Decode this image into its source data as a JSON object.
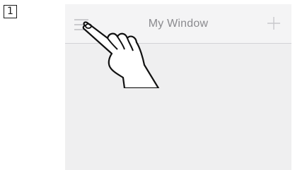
{
  "step": {
    "number": "1"
  },
  "window": {
    "title": "My Window",
    "background_color": "#efeff0",
    "nav_bar_color": "#f4f4f5",
    "icon_color": "#bdbdc1",
    "title_color": "#8a8a8e"
  },
  "nav": {
    "menu_icon": "hamburger-menu-icon",
    "add_icon": "plus-icon"
  },
  "gesture": {
    "icon": "pointing-hand-icon",
    "target": "menu-button"
  }
}
